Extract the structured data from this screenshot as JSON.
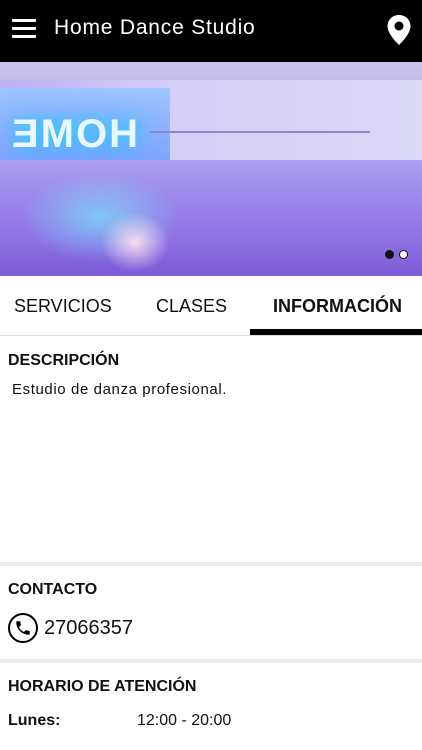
{
  "appbar": {
    "title": "Home Dance Studio"
  },
  "hero": {
    "sign_text": "HOME",
    "slides_total": 2,
    "active_slide": 1
  },
  "tabs": [
    {
      "label": "SERVICIOS",
      "selected": false
    },
    {
      "label": "CLASES",
      "selected": false
    },
    {
      "label": "INFORMACIÓN",
      "selected": true
    }
  ],
  "descripcion": {
    "title": "DESCRIPCIÓN",
    "text": "Estudio de danza profesional."
  },
  "contacto": {
    "title": "CONTACTO",
    "phone": "27066357"
  },
  "horario": {
    "title": "HORARIO DE ATENCIÓN",
    "rows": [
      {
        "day": "Lunes:",
        "hours": "12:00 - 20:00"
      }
    ]
  },
  "colors": {
    "appbar": "#000000",
    "accent": "#000000",
    "divider": "#ececec"
  },
  "icons": {
    "menu": "hamburger-menu-icon",
    "location": "map-pin-icon",
    "phone": "phone-icon"
  }
}
